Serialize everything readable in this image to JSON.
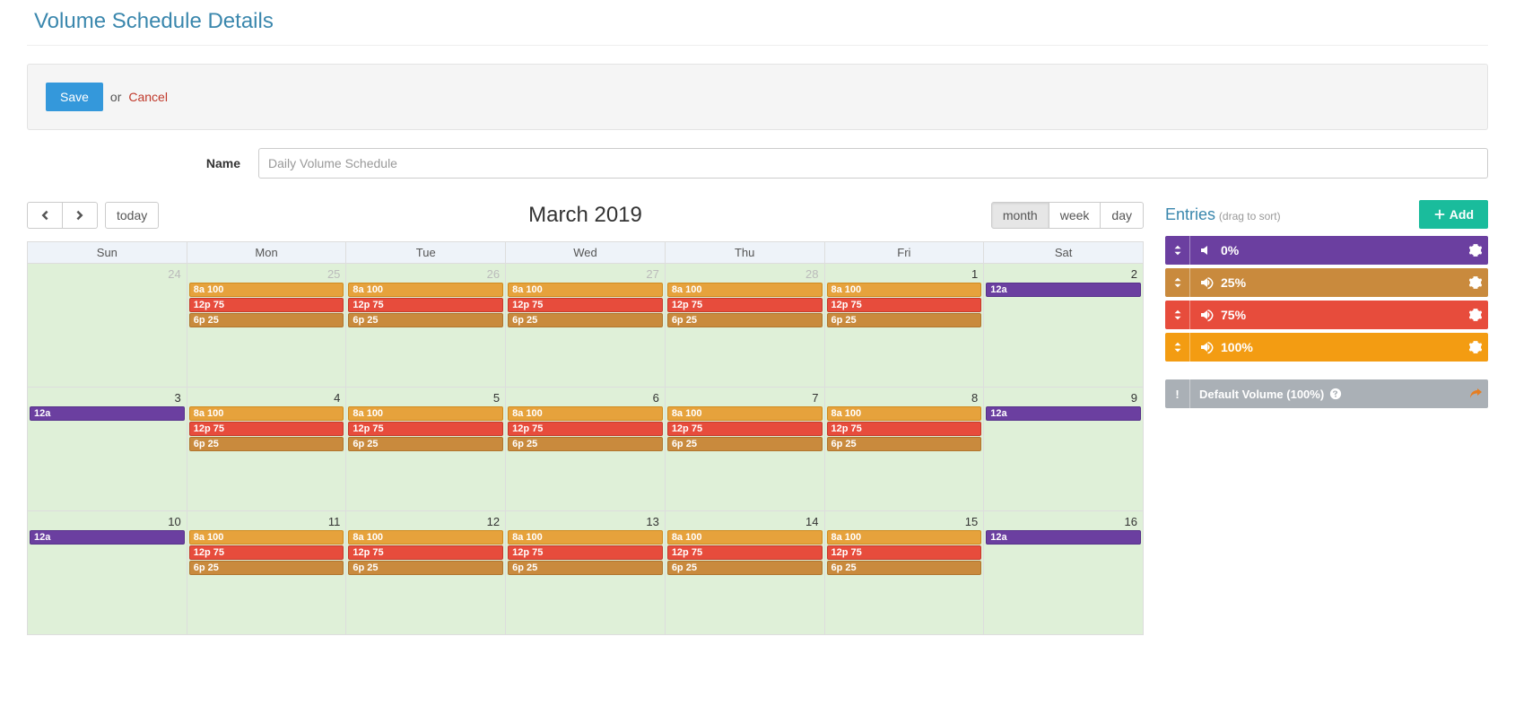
{
  "page_title": "Volume Schedule Details",
  "actions": {
    "save": "Save",
    "or": "or",
    "cancel": "Cancel"
  },
  "form": {
    "name_label": "Name",
    "name_value": "Daily Volume Schedule"
  },
  "calendar": {
    "nav": {
      "today": "today",
      "month": "month",
      "week": "week",
      "day": "day"
    },
    "title": "March 2019",
    "days": [
      "Sun",
      "Mon",
      "Tue",
      "Wed",
      "Thu",
      "Fri",
      "Sat"
    ],
    "weekday_events": [
      {
        "label": "8a 100",
        "color": "orange"
      },
      {
        "label": "12p 75",
        "color": "red"
      },
      {
        "label": "6p 25",
        "color": "brown"
      }
    ],
    "weekend_events": [
      {
        "label": "12a",
        "color": "purple"
      }
    ],
    "weeks": [
      [
        {
          "num": "24",
          "other": true,
          "kind": "none"
        },
        {
          "num": "25",
          "other": true,
          "kind": "weekday"
        },
        {
          "num": "26",
          "other": true,
          "kind": "weekday"
        },
        {
          "num": "27",
          "other": true,
          "kind": "weekday"
        },
        {
          "num": "28",
          "other": true,
          "kind": "weekday"
        },
        {
          "num": "1",
          "other": false,
          "kind": "weekday"
        },
        {
          "num": "2",
          "other": false,
          "kind": "weekend"
        }
      ],
      [
        {
          "num": "3",
          "other": false,
          "kind": "weekend"
        },
        {
          "num": "4",
          "other": false,
          "kind": "weekday"
        },
        {
          "num": "5",
          "other": false,
          "kind": "weekday"
        },
        {
          "num": "6",
          "other": false,
          "kind": "weekday"
        },
        {
          "num": "7",
          "other": false,
          "kind": "weekday"
        },
        {
          "num": "8",
          "other": false,
          "kind": "weekday"
        },
        {
          "num": "9",
          "other": false,
          "kind": "weekend"
        }
      ],
      [
        {
          "num": "10",
          "other": false,
          "kind": "weekend"
        },
        {
          "num": "11",
          "other": false,
          "kind": "weekday"
        },
        {
          "num": "12",
          "other": false,
          "kind": "weekday"
        },
        {
          "num": "13",
          "other": false,
          "kind": "weekday"
        },
        {
          "num": "14",
          "other": false,
          "kind": "weekday"
        },
        {
          "num": "15",
          "other": false,
          "kind": "weekday"
        },
        {
          "num": "16",
          "other": false,
          "kind": "weekend"
        }
      ]
    ]
  },
  "entries": {
    "title": "Entries",
    "subtitle": "(drag to sort)",
    "add": "Add",
    "items": [
      {
        "label": "0%",
        "color": "purple",
        "icon": "mute"
      },
      {
        "label": "25%",
        "color": "brown",
        "icon": "vol"
      },
      {
        "label": "75%",
        "color": "red",
        "icon": "vol"
      },
      {
        "label": "100%",
        "color": "orange2",
        "icon": "vol"
      }
    ],
    "default_label": "Default Volume (100%)"
  }
}
